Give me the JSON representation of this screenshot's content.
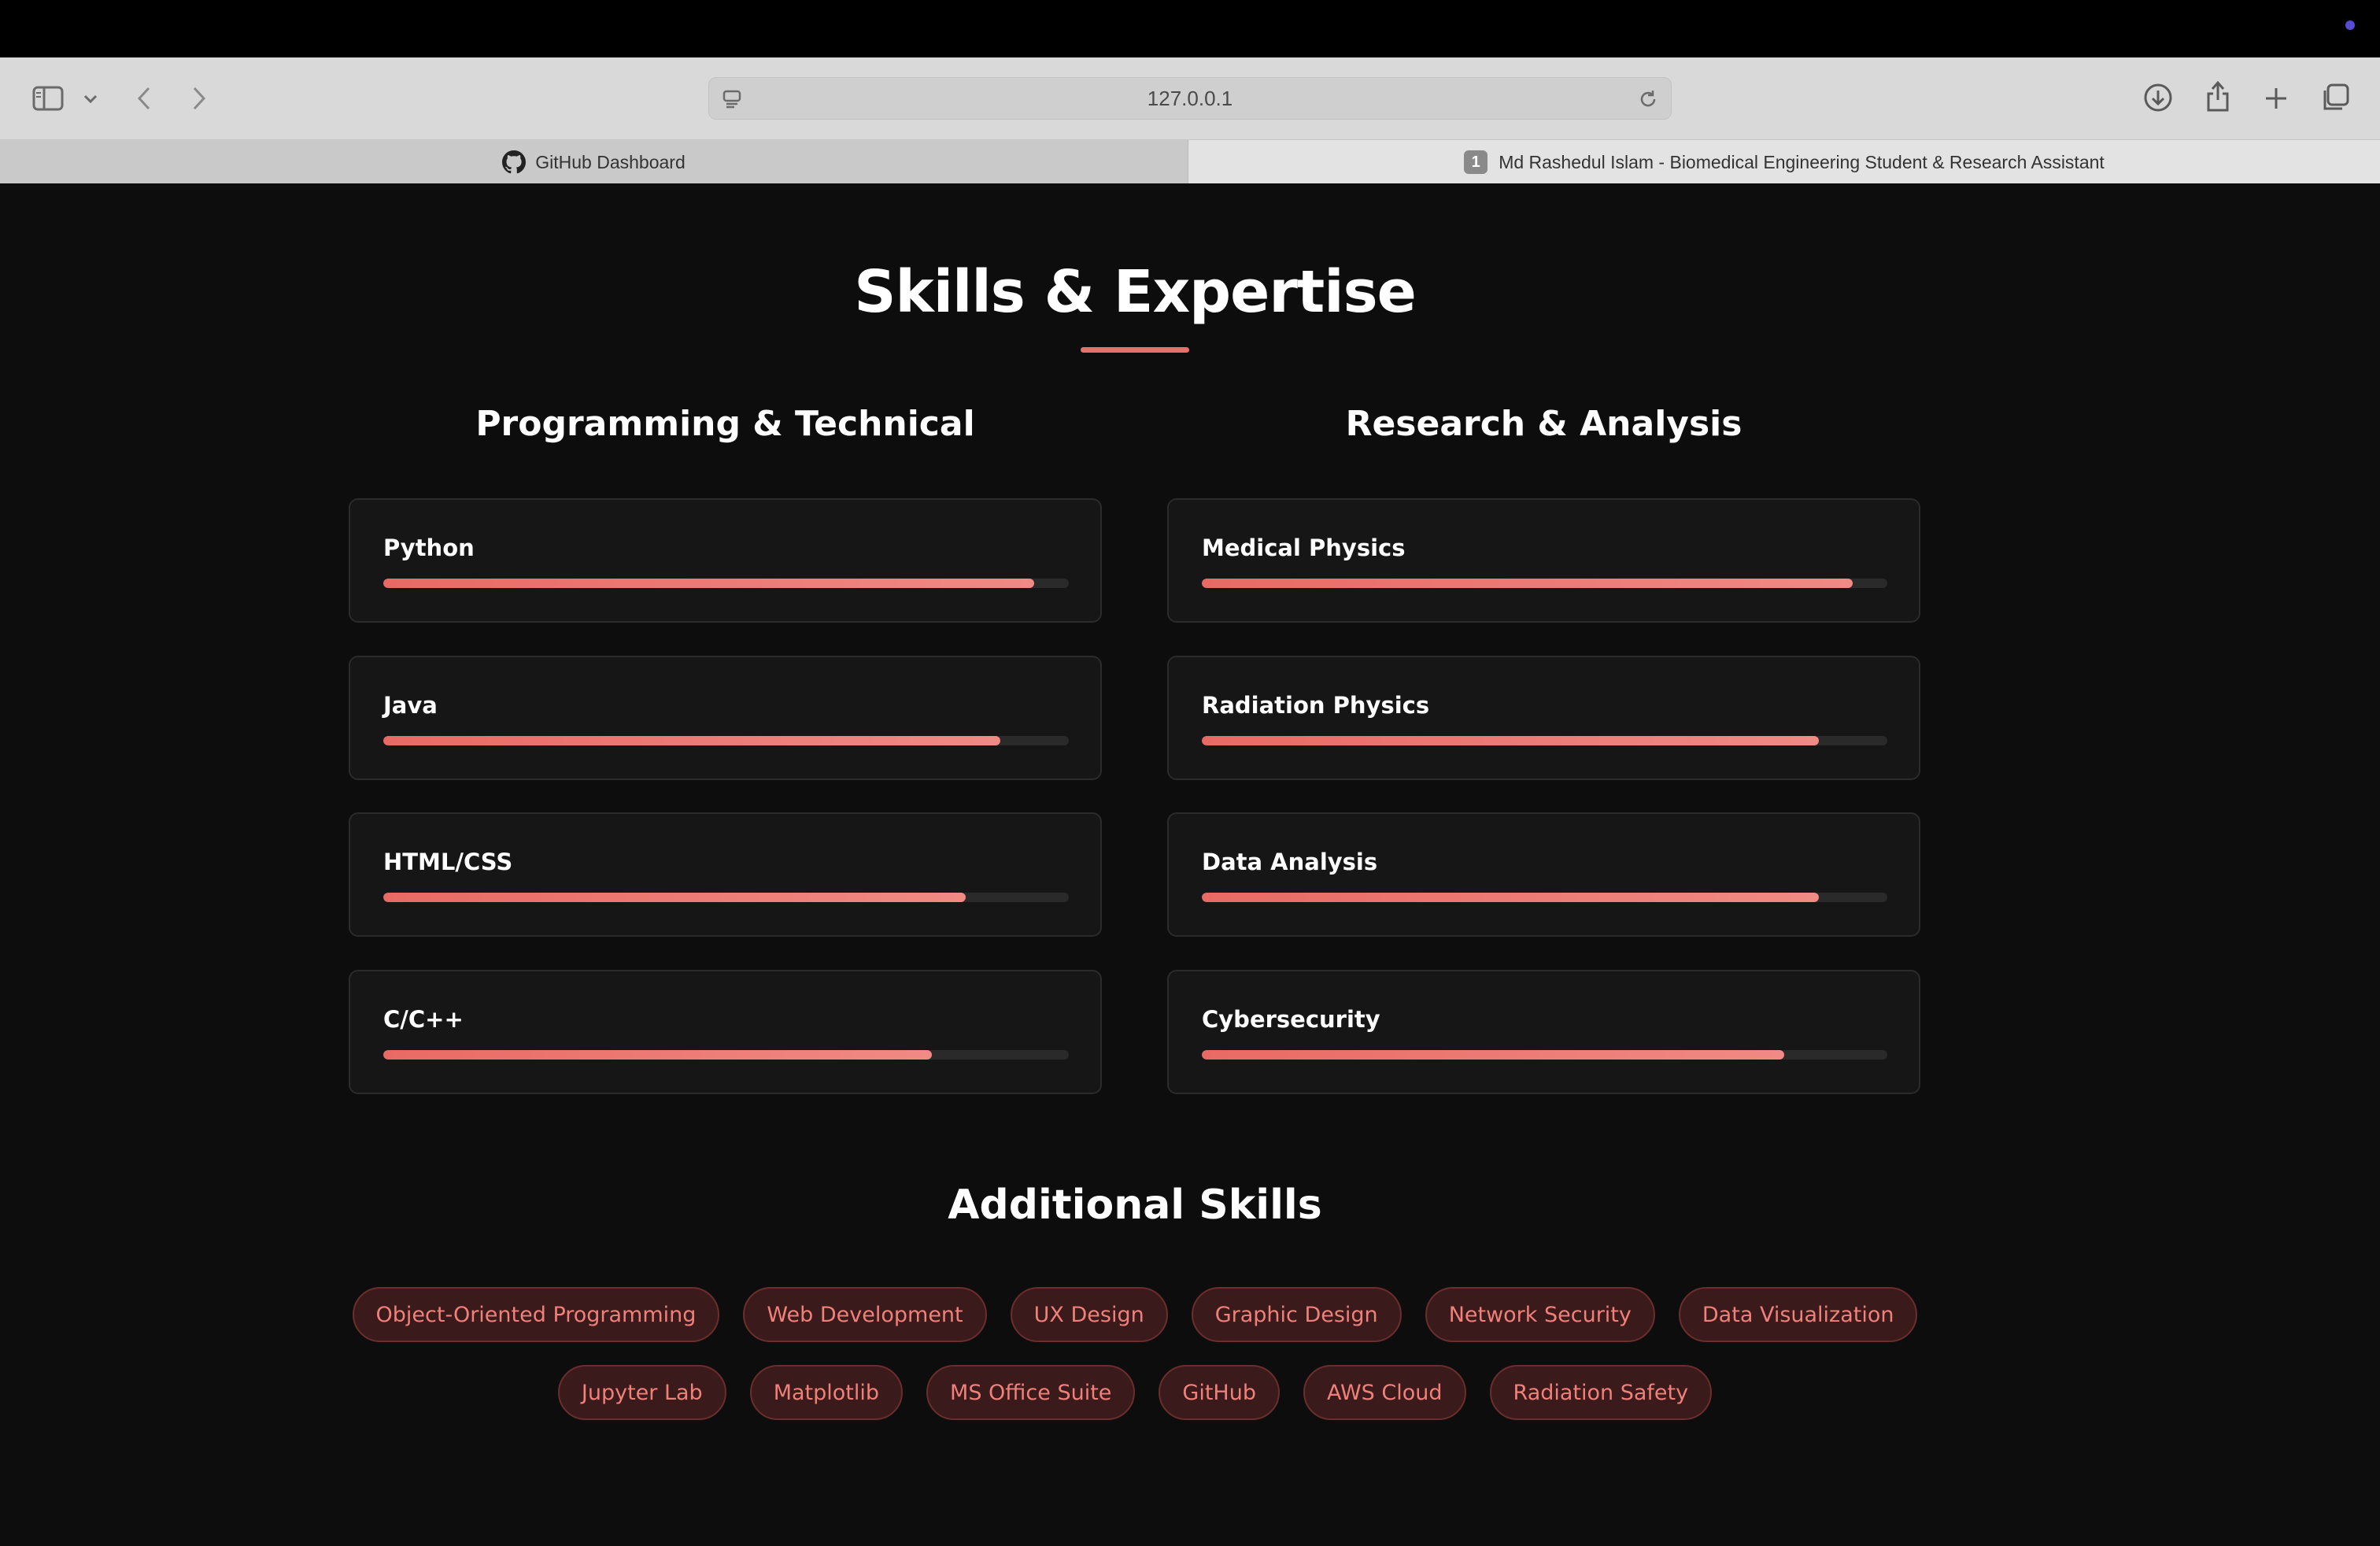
{
  "browser": {
    "address": "127.0.0.1",
    "tabs": [
      {
        "label": "GitHub Dashboard",
        "active": false
      },
      {
        "label": "Md Rashedul Islam - Biomedical Engineering Student & Research Assistant",
        "badge": "1",
        "active": true
      }
    ]
  },
  "section": {
    "title": "Skills & Expertise",
    "accent_color": "#e8706b"
  },
  "columns": {
    "left": {
      "title": "Programming & Technical",
      "skills": [
        {
          "name": "Python",
          "level": 0.95
        },
        {
          "name": "Java",
          "level": 0.9
        },
        {
          "name": "HTML/CSS",
          "level": 0.85
        },
        {
          "name": "C/C++",
          "level": 0.8
        }
      ]
    },
    "right": {
      "title": "Research & Analysis",
      "skills": [
        {
          "name": "Medical Physics",
          "level": 0.95
        },
        {
          "name": "Radiation Physics",
          "level": 0.9
        },
        {
          "name": "Data Analysis",
          "level": 0.9
        },
        {
          "name": "Cybersecurity",
          "level": 0.85
        }
      ]
    }
  },
  "additional": {
    "title": "Additional Skills",
    "row1": [
      "Object-Oriented Programming",
      "Web Development",
      "UX Design",
      "Graphic Design",
      "Network Security",
      "Data Visualization"
    ],
    "row2": [
      "Jupyter Lab",
      "Matplotlib",
      "MS Office Suite",
      "GitHub",
      "AWS Cloud",
      "Radiation Safety"
    ]
  },
  "icons": {
    "sidebar": "sidebar-icon",
    "back": "chevron-left-icon",
    "forward": "chevron-right-icon",
    "reload": "reload-icon",
    "download": "download-icon",
    "share": "share-icon",
    "new_tab": "plus-icon",
    "tab_overview": "tabs-icon"
  }
}
